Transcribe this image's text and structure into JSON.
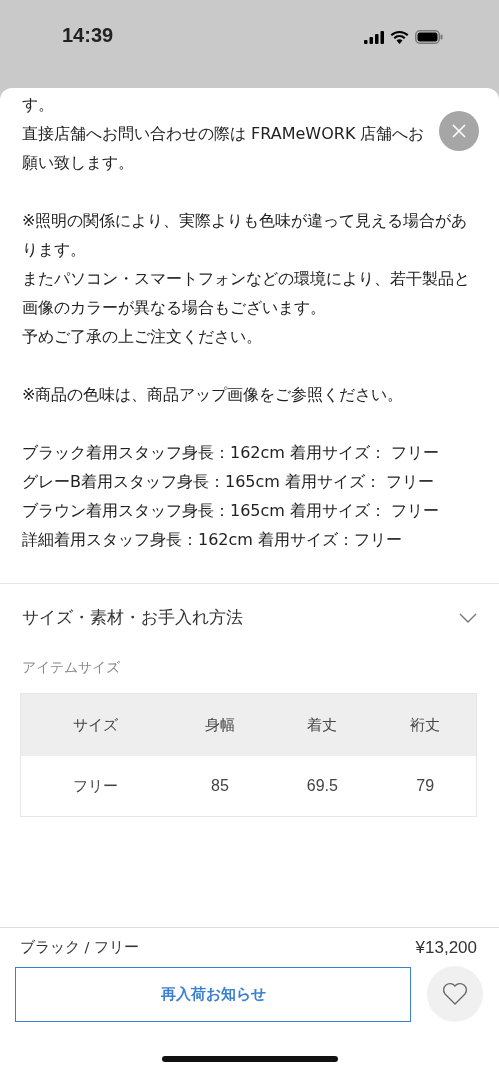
{
  "status_bar": {
    "time": "14:39"
  },
  "sheet": {
    "blocks": [
      [
        "す。",
        "直接店舗へお問い合わせの際は FRAMeWORK 店舗へお願い致します。"
      ],
      [
        "※照明の関係により、実際よりも色味が違って見える場合があります。",
        "またパソコン・スマートフォンなどの環境により、若干製品と画像のカラーが異なる場合もございます。",
        "予めご了承の上ご注文ください。"
      ],
      [
        "※商品の色味は、商品アップ画像をご参照ください。"
      ],
      [
        "ブラック着用スタッフ身長：162cm 着用サイズ： フリー",
        "グレーB着用スタッフ身長：165cm 着用サイズ： フリー",
        "ブラウン着用スタッフ身長：165cm 着用サイズ： フリー",
        "詳細着用スタッフ身長：162cm 着用サイズ：フリー"
      ]
    ],
    "accordion_title": "サイズ・素材・お手入れ方法",
    "size_label": "アイテムサイズ",
    "table": {
      "columns": [
        "サイズ",
        "身幅",
        "着丈",
        "裄丈"
      ],
      "rows": [
        [
          "フリー",
          "85",
          "69.5",
          "79"
        ]
      ]
    }
  },
  "footer": {
    "variant": "ブラック / フリー",
    "price": "¥13,200",
    "button": "再入荷お知らせ"
  }
}
